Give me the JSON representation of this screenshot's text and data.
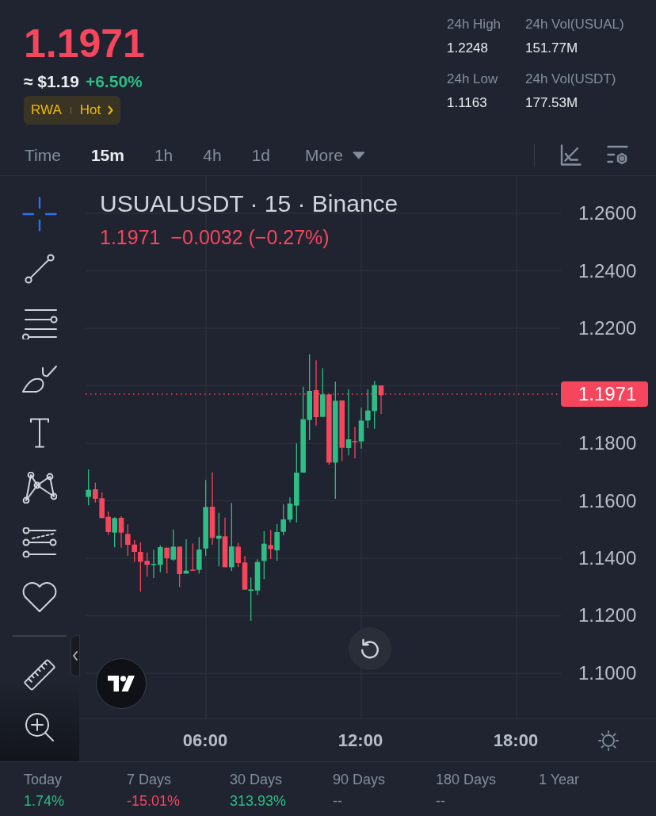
{
  "ticker": {
    "price": "1.1971",
    "fiat_price": "≈ $1.19",
    "change": "+6.50%",
    "tags": [
      {
        "label": "RWA",
        "kind": "tag"
      },
      {
        "label": "Hot",
        "kind": "link"
      }
    ]
  },
  "stats": [
    {
      "label": "24h High",
      "value": "1.2248"
    },
    {
      "label": "24h Vol(USUAL)",
      "value": "151.77M"
    },
    {
      "label": "24h Low",
      "value": "1.1163"
    },
    {
      "label": "24h Vol(USDT)",
      "value": "177.53M"
    }
  ],
  "intervals": [
    {
      "label": "Time",
      "kind": "interval",
      "selected": false
    },
    {
      "label": "15m",
      "kind": "interval",
      "selected": true
    },
    {
      "label": "1h",
      "kind": "interval",
      "selected": false
    },
    {
      "label": "4h",
      "kind": "interval",
      "selected": false
    },
    {
      "label": "1d",
      "kind": "interval",
      "selected": false
    },
    {
      "label": "More",
      "kind": "dropdown",
      "selected": false
    }
  ],
  "drawing_tools": [
    {
      "kind": "crosshair",
      "selected": true
    },
    {
      "kind": "trend-line",
      "selected": false
    },
    {
      "kind": "parallel-lines",
      "selected": false
    },
    {
      "kind": "brush",
      "selected": false
    },
    {
      "kind": "text",
      "selected": false
    },
    {
      "kind": "pattern",
      "selected": false
    },
    {
      "kind": "fibonacci",
      "selected": false
    },
    {
      "kind": "favorites",
      "selected": false
    }
  ],
  "measure_tools": [
    {
      "kind": "ruler",
      "selected": false
    },
    {
      "kind": "zoom",
      "selected": false
    }
  ],
  "chart": {
    "legend": {
      "title": "USUALUSDT · 15 · Binance",
      "last": "1.1971",
      "change": "−0.0032 (−0.27%)"
    },
    "price_axis": [
      "1.2600",
      "1.2400",
      "1.2200",
      "1.1800",
      "1.1600",
      "1.1400",
      "1.1200",
      "1.1000"
    ],
    "price_tag": "1.1971",
    "time_axis": [
      "06:00",
      "12:00",
      "18:00"
    ]
  },
  "performance": [
    {
      "label": "Today",
      "value": "1.74%",
      "color": "#2ebd85"
    },
    {
      "label": "7 Days",
      "value": "-15.01%",
      "color": "#f6465d"
    },
    {
      "label": "30 Days",
      "value": "313.93%",
      "color": "#2ebd85"
    },
    {
      "label": "90 Days",
      "value": "--",
      "color": "#848e9c"
    },
    {
      "label": "180 Days",
      "value": "--",
      "color": "#848e9c"
    },
    {
      "label": "1 Year"
    }
  ]
}
